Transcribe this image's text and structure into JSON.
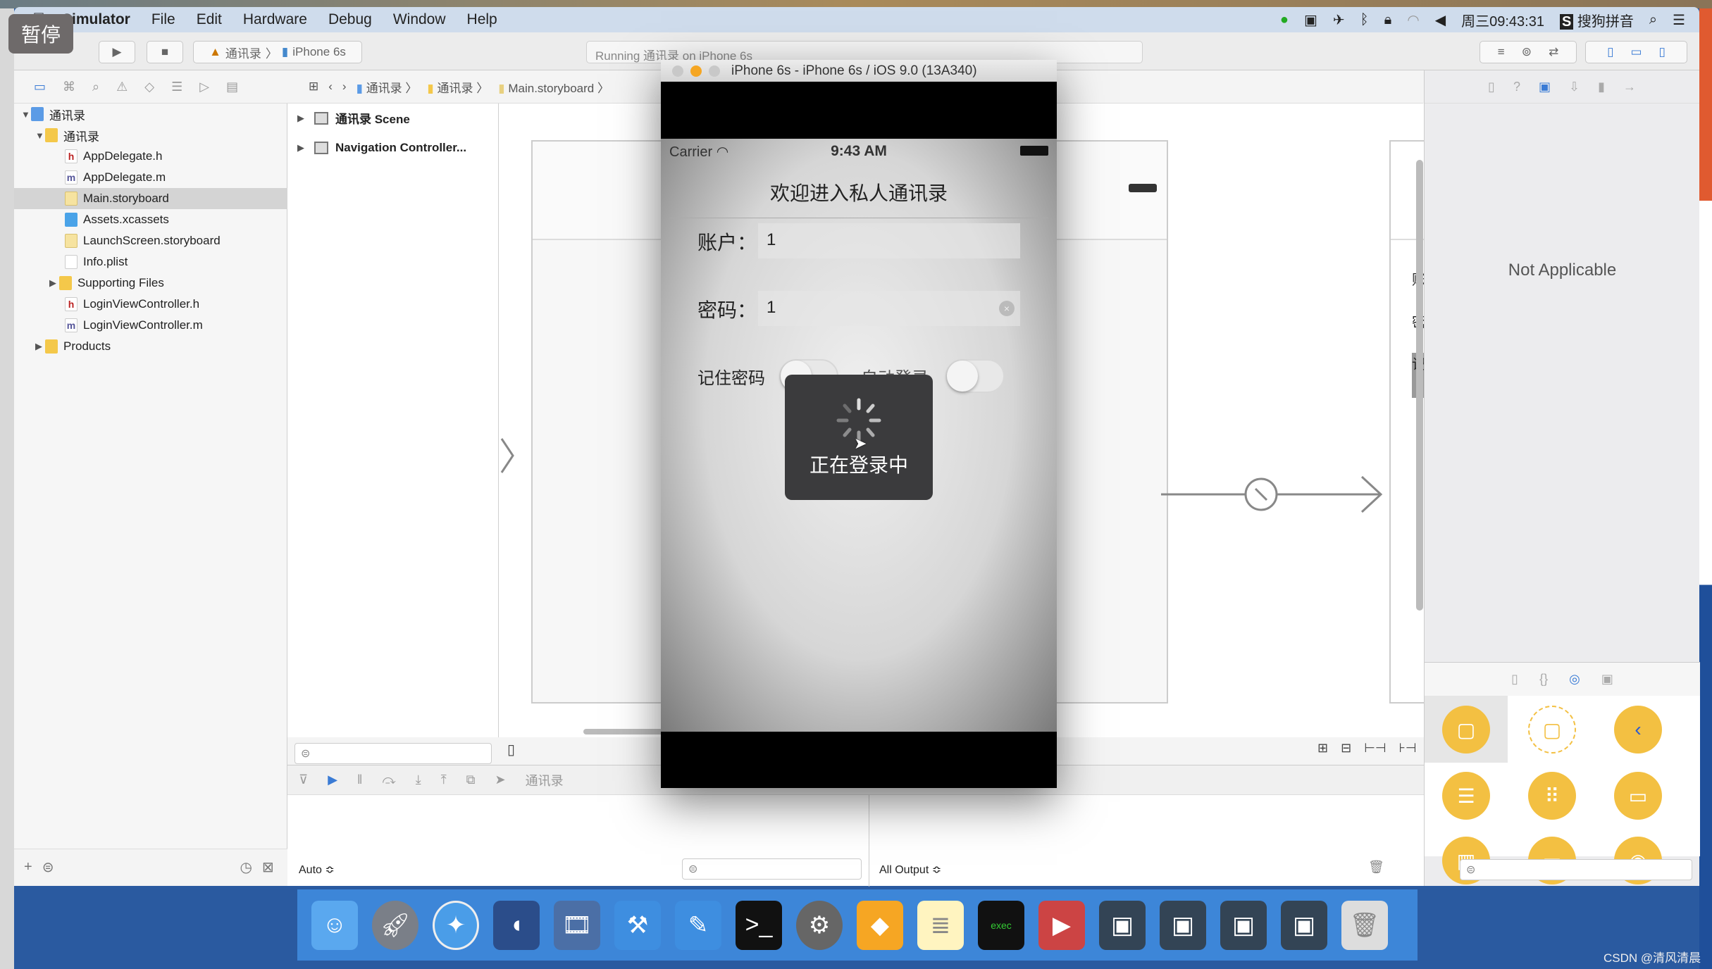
{
  "menubar": {
    "app": "Simulator",
    "items": [
      "File",
      "Edit",
      "Hardware",
      "Debug",
      "Window",
      "Help"
    ],
    "clock": "周三09:43:31",
    "ime": "搜狗拼音"
  },
  "overlay": {
    "pause_badge": "暂停"
  },
  "toolbar": {
    "scheme": "通讯录",
    "device": "iPhone 6s",
    "activity": "Running 通讯录 on iPhone 6s"
  },
  "jumpbar": {
    "items": [
      "通讯录",
      "通讯录",
      "Main.storyboard"
    ]
  },
  "navigator": {
    "items": [
      {
        "label": "通讯录",
        "icon": "project-icon"
      },
      {
        "label": "通讯录",
        "icon": "folder-icon"
      },
      {
        "label": "AppDelegate.h",
        "icon": "header-file-icon",
        "glyph": "h"
      },
      {
        "label": "AppDelegate.m",
        "icon": "impl-file-icon",
        "glyph": "m"
      },
      {
        "label": "Main.storyboard",
        "icon": "storyboard-icon",
        "selected": true
      },
      {
        "label": "Assets.xcassets",
        "icon": "assets-icon"
      },
      {
        "label": "LaunchScreen.storyboard",
        "icon": "storyboard-icon"
      },
      {
        "label": "Info.plist",
        "icon": "plist-icon"
      },
      {
        "label": "Supporting Files",
        "icon": "folder-icon"
      },
      {
        "label": "LoginViewController.h",
        "icon": "header-file-icon",
        "glyph": "h"
      },
      {
        "label": "LoginViewController.m",
        "icon": "impl-file-icon",
        "glyph": "m"
      },
      {
        "label": "Products",
        "icon": "folder-icon"
      }
    ]
  },
  "outline": {
    "items": [
      "通讯录 Scene",
      "Navigation Controller..."
    ]
  },
  "canvas": {
    "partial_labels": [
      "账",
      "密",
      "记"
    ]
  },
  "inspector": {
    "empty": "Not Applicable"
  },
  "debug": {
    "scope": "Auto ≎",
    "output": "All Output ≎",
    "breadcrumb": "通讯录"
  },
  "simulator": {
    "title": "iPhone 6s - iPhone 6s / iOS 9.0 (13A340)",
    "carrier": "Carrier",
    "time": "9:43 AM",
    "nav_title": "欢迎进入私人通讯录",
    "account_label": "账户：",
    "account_value": "1",
    "password_label": "密码：",
    "password_value": "1",
    "remember_label": "记住密码",
    "autologin_label": "自动登录",
    "remember_on": false,
    "autologin_on": false,
    "hud_text": "正在登录中"
  },
  "watermark": "CSDN @清风清晨"
}
